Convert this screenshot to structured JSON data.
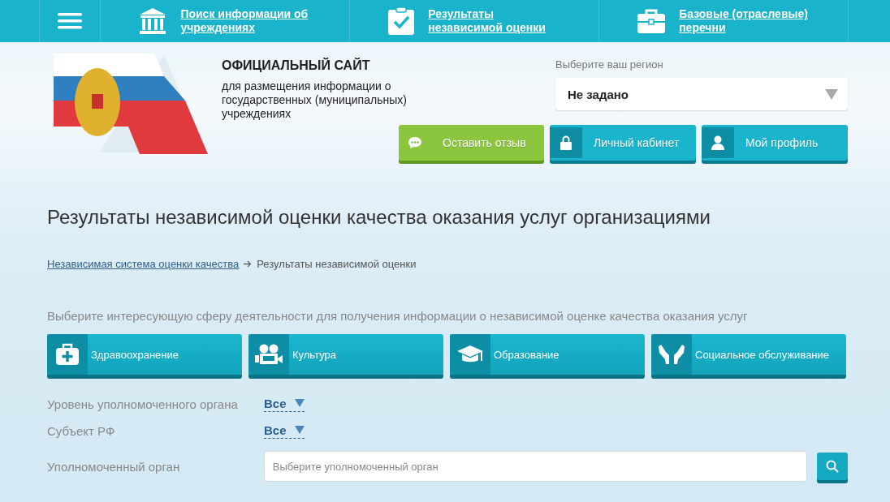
{
  "top_nav": {
    "items": [
      {
        "kind": "institution",
        "label": "Поиск информации об учреждениях"
      },
      {
        "kind": "checklist",
        "label": "Результаты независимой оценки"
      },
      {
        "kind": "briefcase",
        "label": "Базовые (отраслевые) перечни"
      }
    ]
  },
  "header": {
    "site_title": "ОФИЦИАЛЬНЫЙ САЙТ",
    "site_subtitle": "для размещения информации о государственных (муниципальных) учреждениях",
    "region": {
      "label": "Выберите ваш регион",
      "value": "Не задано"
    },
    "buttons": [
      {
        "kind": "feedback",
        "label": "Оставить отзыв"
      },
      {
        "kind": "lock",
        "label": "Личный кабинет"
      },
      {
        "kind": "person",
        "label": "Мой профиль"
      }
    ]
  },
  "page_title": "Результаты независимой оценки качества оказания услуг организациями",
  "breadcrumbs": [
    {
      "label": "Независимая система оценки качества",
      "link": true
    },
    {
      "label": "Результаты независимой оценки",
      "link": false
    }
  ],
  "prompt": "Выберите интересующую сферу деятельности для получения информации о независимой оценке качества оказания услуг",
  "categories": [
    {
      "kind": "health",
      "label": "Здравоохранение"
    },
    {
      "kind": "culture",
      "label": "Культура"
    },
    {
      "kind": "education",
      "label": "Образование"
    },
    {
      "kind": "social",
      "label": "Социальное обслуживание"
    }
  ],
  "filters": [
    {
      "label": "Уровень уполномоченного органа",
      "value": "Все"
    },
    {
      "label": "Субъект РФ",
      "value": "Все"
    }
  ],
  "authority_search": {
    "label": "Уполномоченный орган",
    "placeholder": "Выберите уполномоченный орган"
  }
}
